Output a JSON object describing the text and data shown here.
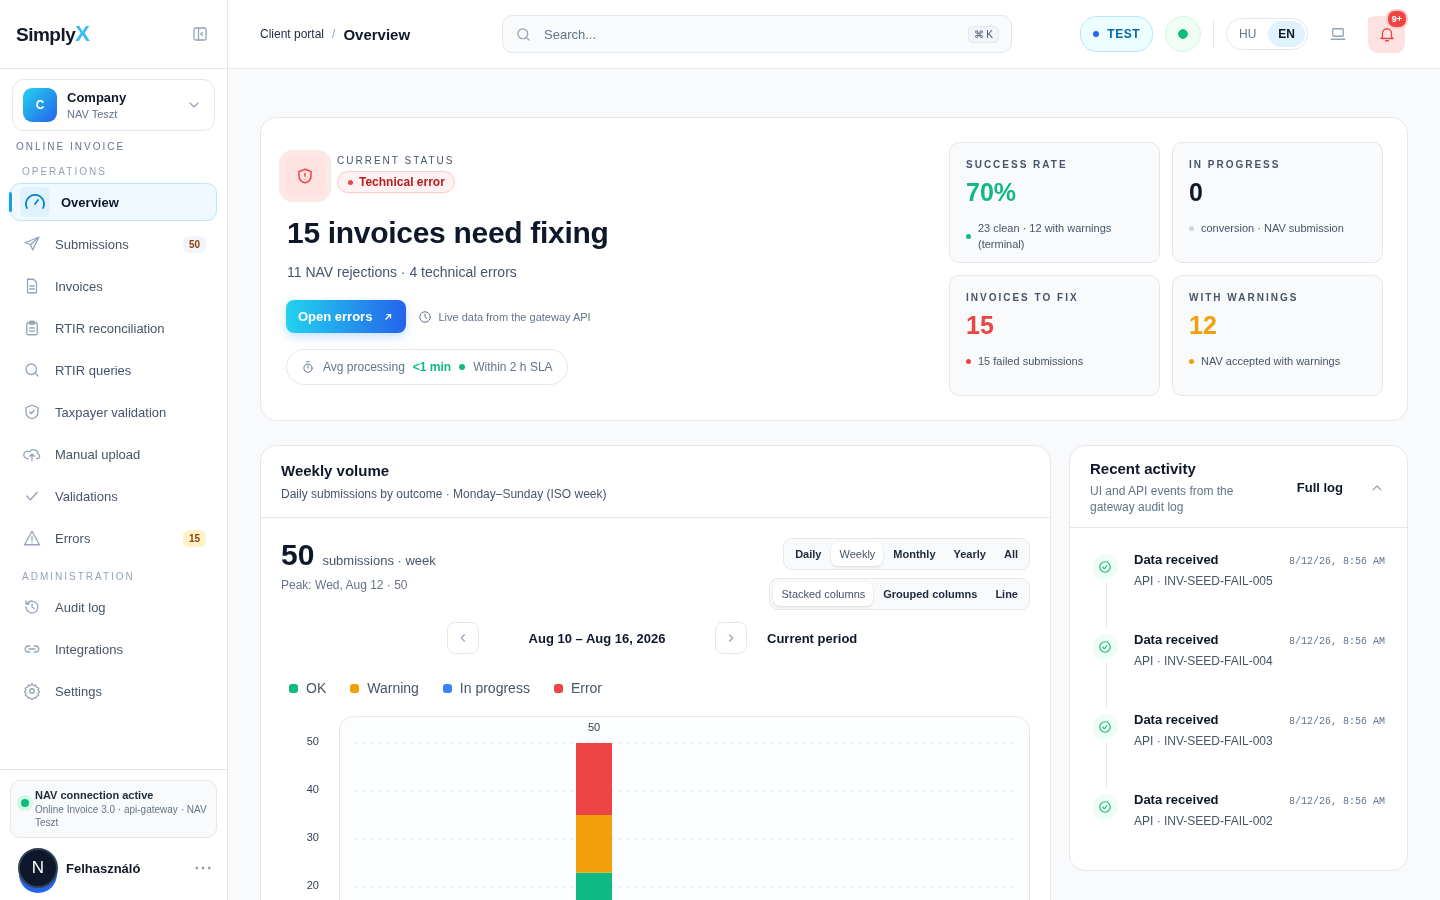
{
  "sidebar": {
    "logo": {
      "text": "Simply",
      "mark": "X"
    },
    "company": {
      "avatar": "C",
      "name": "Company",
      "subtitle": "NAV Teszt"
    },
    "section_label": "ONLINE INVOICE",
    "groups": [
      {
        "title": "OPERATIONS",
        "items": [
          {
            "label": "Overview",
            "selected": true
          },
          {
            "label": "Submissions",
            "badge": "50",
            "color": "#f1f5f9",
            "selected": false
          },
          {
            "label": "Invoices",
            "selected": false
          },
          {
            "label": "RTIR reconciliation",
            "selected": false
          },
          {
            "label": "RTIR queries",
            "selected": false
          },
          {
            "label": "Taxpayer validation",
            "selected": false
          },
          {
            "label": "Manual upload",
            "selected": false
          },
          {
            "label": "Validations",
            "selected": false
          },
          {
            "label": "Errors",
            "badge": "15",
            "color": "#fef3c7",
            "selected": false
          }
        ]
      },
      {
        "title": "ADMINISTRATION",
        "items": [
          {
            "label": "Audit log",
            "selected": false
          },
          {
            "label": "Integrations",
            "selected": false
          },
          {
            "label": "Settings",
            "selected": false
          }
        ]
      }
    ],
    "connection": {
      "title": "NAV connection active",
      "detail": "Online Invoice 3.0 · api-gateway · NAV Teszt"
    },
    "user": {
      "initial": "N",
      "name": "Felhasználó"
    }
  },
  "header": {
    "breadcrumb": [
      "Client portal",
      "Overview"
    ],
    "breadcrumb_separator": "/",
    "search": {
      "placeholder": "Search...",
      "shortcut": "⌘ K"
    },
    "environment": "TEST",
    "languages": [
      {
        "label": "HU",
        "selected": false
      },
      {
        "label": "EN",
        "selected": true
      }
    ],
    "notifications": "9+"
  },
  "hero": {
    "eyebrow": "CURRENT STATUS",
    "status": "Technical error",
    "title": "15 invoices need fixing",
    "subtitle": "11 NAV rejections · 4 technical errors",
    "button": "Open errors",
    "live_note": "Live data from the gateway API",
    "processing": {
      "label": "Avg processing",
      "value": "<1 min",
      "sla": "Within 2 h SLA"
    },
    "stats": [
      {
        "label": "SUCCESS RATE",
        "value": "70%",
        "note": "23 clean · 12 with warnings (terminal)",
        "color": "#10b981",
        "kind": "accent"
      },
      {
        "label": "IN PROGRESS",
        "value": "0",
        "note": "conversion · NAV submission",
        "color": "#d1d5db",
        "kind": "neutral"
      },
      {
        "label": "INVOICES TO FIX",
        "value": "15",
        "note": "15 failed submissions",
        "color": "#ef4444",
        "kind": "accent"
      },
      {
        "label": "WITH WARNINGS",
        "value": "12",
        "note": "NAV accepted with warnings",
        "color": "#f59e0b",
        "kind": "accent"
      }
    ]
  },
  "volume": {
    "title": "Weekly volume",
    "subtitle": "Daily submissions by outcome · Monday–Sunday (ISO week)",
    "total": "50",
    "total_unit": "submissions · week",
    "peak": "Peak: Wed, Aug 12 · 50",
    "ranges": [
      {
        "label": "Daily",
        "selected": false
      },
      {
        "label": "Weekly",
        "selected": true
      },
      {
        "label": "Monthly",
        "selected": false
      },
      {
        "label": "Yearly",
        "selected": false
      },
      {
        "label": "All",
        "selected": false
      }
    ],
    "modes": [
      {
        "label": "Stacked columns",
        "selected": true
      },
      {
        "label": "Grouped columns",
        "selected": false
      },
      {
        "label": "Line",
        "selected": false
      }
    ],
    "period": "Aug 10 – Aug 16, 2026",
    "current": "Current period",
    "chart_data": {
      "type": "bar",
      "stacked": true,
      "grid": true,
      "value_labels": [
        null,
        null,
        "50",
        null,
        null,
        null,
        null
      ],
      "ylim": [
        0,
        50
      ],
      "yticks": [
        20,
        30,
        40,
        50
      ],
      "series": [
        {
          "name": "OK",
          "color": "#10b981",
          "values": [
            0,
            0,
            23,
            0,
            0,
            0,
            0
          ]
        },
        {
          "name": "Warning",
          "color": "#f59e0b",
          "values": [
            0,
            0,
            12,
            0,
            0,
            0,
            0
          ]
        },
        {
          "name": "In progress",
          "color": "#3b82f6",
          "values": [
            0,
            0,
            0,
            0,
            0,
            0,
            0
          ]
        },
        {
          "name": "Error",
          "color": "#ef4444",
          "values": [
            0,
            0,
            15,
            0,
            0,
            0,
            0
          ]
        }
      ]
    }
  },
  "activity": {
    "title": "Recent activity",
    "subtitle": "UI and API events from the gateway audit log",
    "link": "Full log",
    "expanded": true,
    "items": [
      {
        "title": "Data received",
        "detail": "API · INV-SEED-FAIL-005",
        "time": "8/12/26, 8:56 AM"
      },
      {
        "title": "Data received",
        "detail": "API · INV-SEED-FAIL-004",
        "time": "8/12/26, 8:56 AM"
      },
      {
        "title": "Data received",
        "detail": "API · INV-SEED-FAIL-003",
        "time": "8/12/26, 8:56 AM"
      },
      {
        "title": "Data received",
        "detail": "API · INV-SEED-FAIL-002",
        "time": "8/12/26, 8:56 AM"
      }
    ]
  }
}
